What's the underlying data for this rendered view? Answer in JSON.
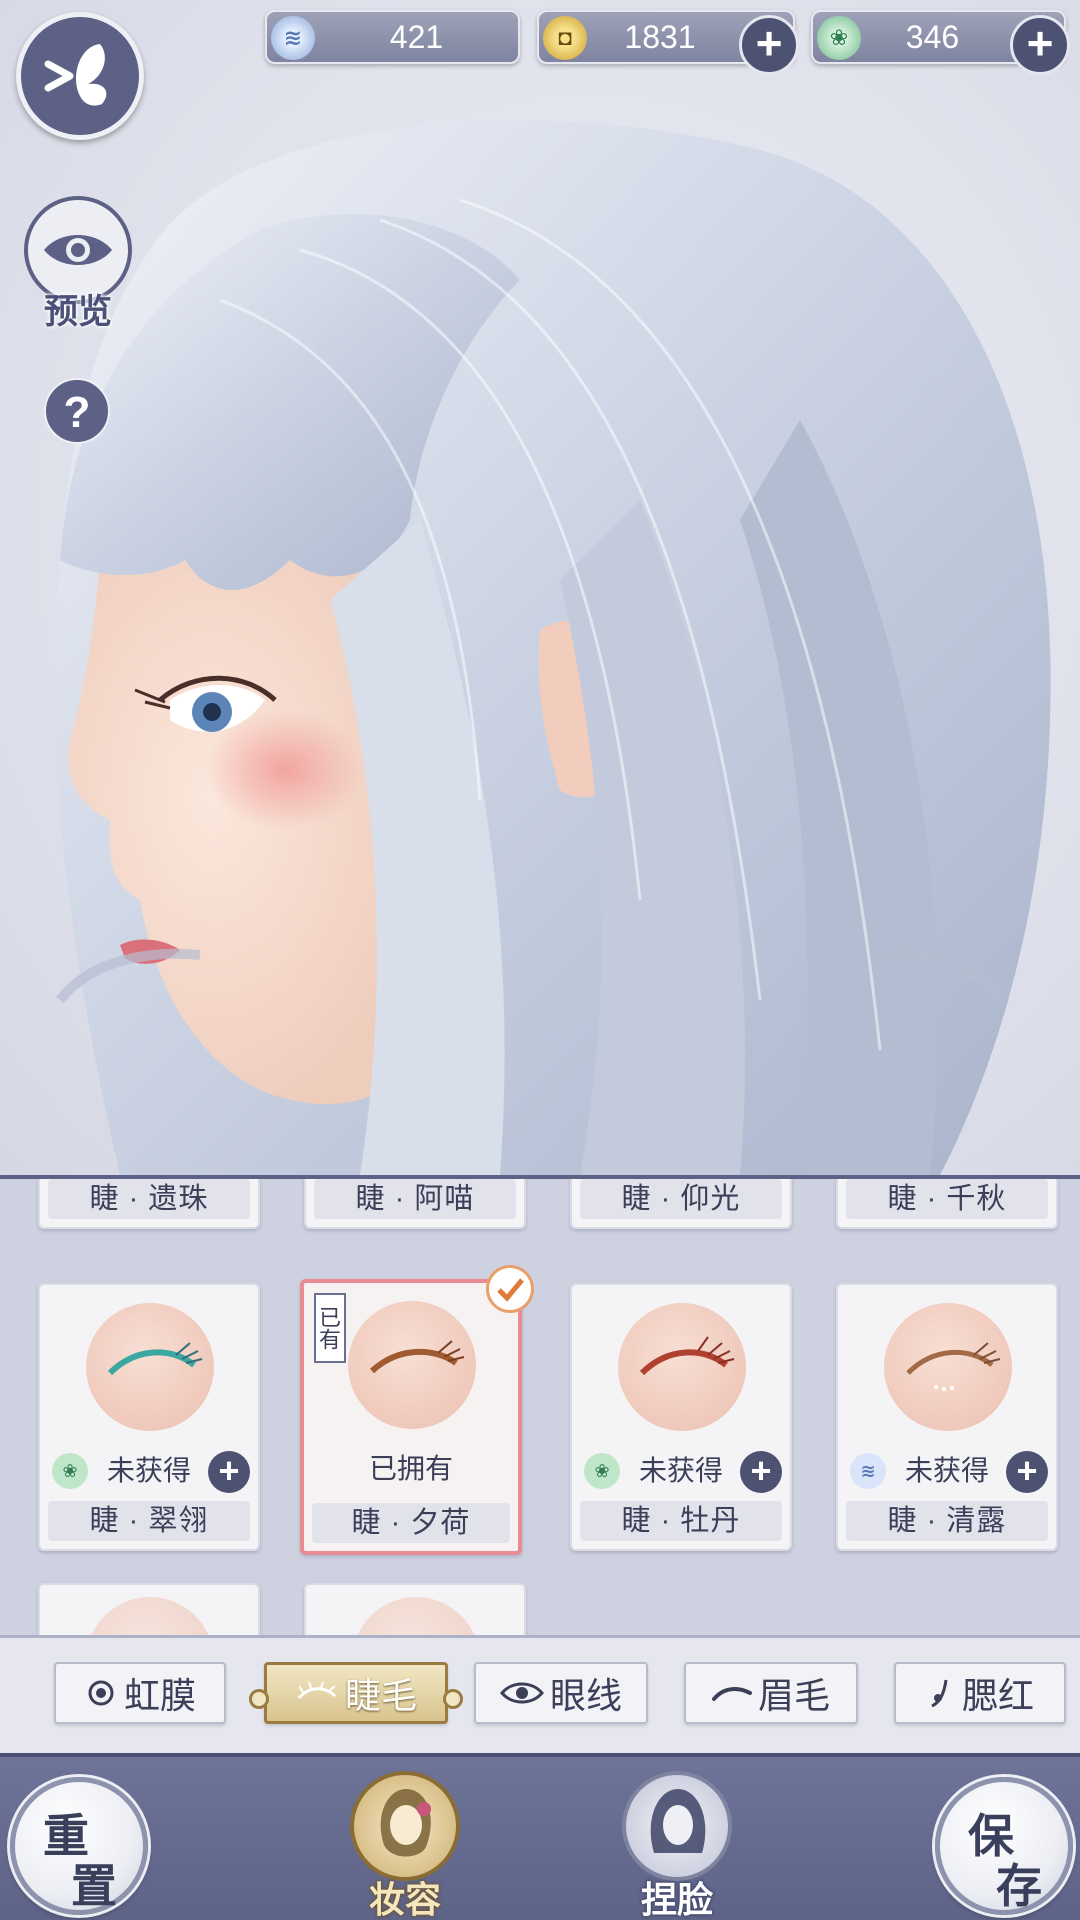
{
  "currencies": [
    {
      "name": "silver-jade-coin",
      "amount": "421",
      "has_plus": false
    },
    {
      "name": "copper-coin",
      "amount": "1831",
      "has_plus": true
    },
    {
      "name": "green-jade",
      "amount": "346",
      "has_plus": true
    }
  ],
  "side": {
    "preview_label": "预览",
    "help_label": "?"
  },
  "items_row0": [
    {
      "name": "睫 · 遗珠"
    },
    {
      "name": "睫 · 阿喵"
    },
    {
      "name": "睫 · 仰光"
    },
    {
      "name": "睫 · 千秋"
    }
  ],
  "items_row1": [
    {
      "name": "睫 · 翠翎",
      "status": "未获得",
      "currency": "green-jade",
      "lash_color": "#3aa8a0"
    },
    {
      "name": "睫 · 夕荷",
      "status": "已拥有",
      "owned_tag": "已有",
      "selected": true,
      "lash_color": "#a05a30"
    },
    {
      "name": "睫 · 牡丹",
      "status": "未获得",
      "currency": "green-jade",
      "lash_color": "#b0402f"
    },
    {
      "name": "睫 · 清露",
      "status": "未获得",
      "currency": "silver-jade-coin",
      "lash_color": "#a36a45"
    }
  ],
  "tabs": [
    {
      "label": "虹膜",
      "icon": "iris-icon",
      "active": false
    },
    {
      "label": "睫毛",
      "icon": "eyelash-icon",
      "active": true
    },
    {
      "label": "眼线",
      "icon": "eye-icon",
      "active": false
    },
    {
      "label": "眉毛",
      "icon": "eyebrow-icon",
      "active": false
    },
    {
      "label": "腮红",
      "icon": "blush-icon",
      "active": false
    }
  ],
  "bottom": {
    "reset_c1": "重",
    "reset_c2": "置",
    "makeup_label": "妆容",
    "face_label": "捏脸",
    "save_c1": "保",
    "save_c2": "存"
  },
  "colors": {
    "accent": "#5c6185",
    "gold": "#9a7c42",
    "selected_border": "#e88b92"
  }
}
